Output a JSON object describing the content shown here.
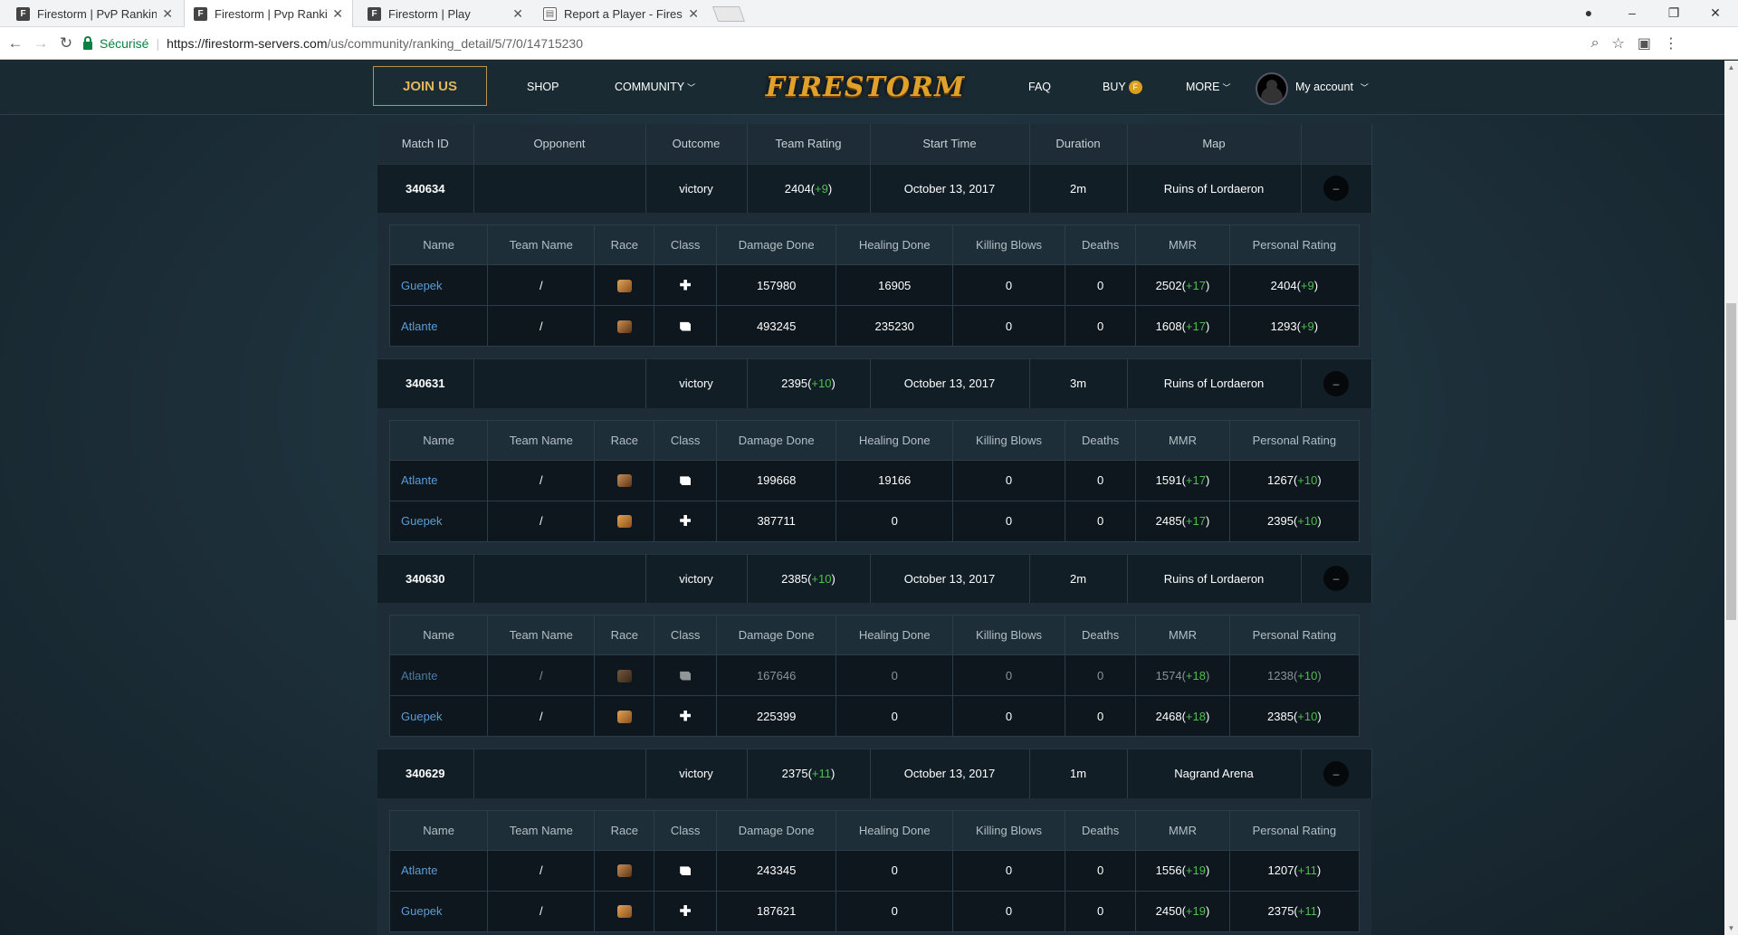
{
  "browser": {
    "tabs": [
      {
        "title": "Firestorm | PvP Ranking",
        "icon": "F"
      },
      {
        "title": "Firestorm | Pvp Ranking",
        "icon": "F"
      },
      {
        "title": "Firestorm | Play",
        "icon": "F"
      },
      {
        "title": "Report a Player - Firesto",
        "icon": "doc"
      }
    ],
    "secure_label": "Sécurisé",
    "url_host": "https://firestorm-servers.com",
    "url_path": "/us/community/ranking_detail/5/7/0/14715230"
  },
  "header": {
    "join": "JOIN US",
    "shop": "SHOP",
    "community": "COMMUNITY",
    "logo": "FIRESTORM",
    "faq": "FAQ",
    "buy": "BUY",
    "more": "MORE",
    "account": "My account"
  },
  "table": {
    "headers": [
      "Match ID",
      "Opponent",
      "Outcome",
      "Team Rating",
      "Start Time",
      "Duration",
      "Map",
      ""
    ],
    "detail_headers": [
      "Name",
      "Team Name",
      "Race",
      "Class",
      "Damage Done",
      "Healing Done",
      "Killing Blows",
      "Deaths",
      "MMR",
      "Personal Rating"
    ],
    "matches": [
      {
        "id": "340634",
        "opponent": "",
        "outcome": "victory",
        "rating": "2404",
        "rating_delta": "+9",
        "start": "October 13, 2017",
        "duration": "2m",
        "map": "Ruins of Lordaeron",
        "toggle": "–",
        "players": [
          {
            "name": "Guepek",
            "team": "/",
            "race": "race-a",
            "class": "cross",
            "damage": "157980",
            "healing": "16905",
            "kb": "0",
            "deaths": "0",
            "mmr": "2502",
            "mmr_delta": "+17",
            "pr": "2404",
            "pr_delta": "+9",
            "dim": false
          },
          {
            "name": "Atlante",
            "team": "/",
            "race": "race-b",
            "class": "fist",
            "damage": "493245",
            "healing": "235230",
            "kb": "0",
            "deaths": "0",
            "mmr": "1608",
            "mmr_delta": "+17",
            "pr": "1293",
            "pr_delta": "+9",
            "dim": false
          }
        ]
      },
      {
        "id": "340631",
        "opponent": "",
        "outcome": "victory",
        "rating": "2395",
        "rating_delta": "+10",
        "start": "October 13, 2017",
        "duration": "3m",
        "map": "Ruins of Lordaeron",
        "toggle": "–",
        "players": [
          {
            "name": "Atlante",
            "team": "/",
            "race": "race-b",
            "class": "fist",
            "damage": "199668",
            "healing": "19166",
            "kb": "0",
            "deaths": "0",
            "mmr": "1591",
            "mmr_delta": "+17",
            "pr": "1267",
            "pr_delta": "+10",
            "dim": false
          },
          {
            "name": "Guepek",
            "team": "/",
            "race": "race-a",
            "class": "cross",
            "damage": "387711",
            "healing": "0",
            "kb": "0",
            "deaths": "0",
            "mmr": "2485",
            "mmr_delta": "+17",
            "pr": "2395",
            "pr_delta": "+10",
            "dim": false
          }
        ]
      },
      {
        "id": "340630",
        "opponent": "",
        "outcome": "victory",
        "rating": "2385",
        "rating_delta": "+10",
        "start": "October 13, 2017",
        "duration": "2m",
        "map": "Ruins of Lordaeron",
        "toggle": "–",
        "players": [
          {
            "name": "Atlante",
            "team": "/",
            "race": "race-b",
            "class": "fist",
            "damage": "167646",
            "healing": "0",
            "kb": "0",
            "deaths": "0",
            "mmr": "1574",
            "mmr_delta": "+18",
            "pr": "1238",
            "pr_delta": "+10",
            "dim": true
          },
          {
            "name": "Guepek",
            "team": "/",
            "race": "race-a",
            "class": "cross",
            "damage": "225399",
            "healing": "0",
            "kb": "0",
            "deaths": "0",
            "mmr": "2468",
            "mmr_delta": "+18",
            "pr": "2385",
            "pr_delta": "+10",
            "dim": false
          }
        ]
      },
      {
        "id": "340629",
        "opponent": "",
        "outcome": "victory",
        "rating": "2375",
        "rating_delta": "+11",
        "start": "October 13, 2017",
        "duration": "1m",
        "map": "Nagrand Arena",
        "toggle": "–",
        "players": [
          {
            "name": "Atlante",
            "team": "/",
            "race": "race-b",
            "class": "fist",
            "damage": "243345",
            "healing": "0",
            "kb": "0",
            "deaths": "0",
            "mmr": "1556",
            "mmr_delta": "+19",
            "pr": "1207",
            "pr_delta": "+11",
            "dim": false
          },
          {
            "name": "Guepek",
            "team": "/",
            "race": "race-a",
            "class": "cross",
            "damage": "187621",
            "healing": "0",
            "kb": "0",
            "deaths": "0",
            "mmr": "2450",
            "mmr_delta": "+19",
            "pr": "2375",
            "pr_delta": "+11",
            "dim": false
          }
        ]
      }
    ]
  }
}
